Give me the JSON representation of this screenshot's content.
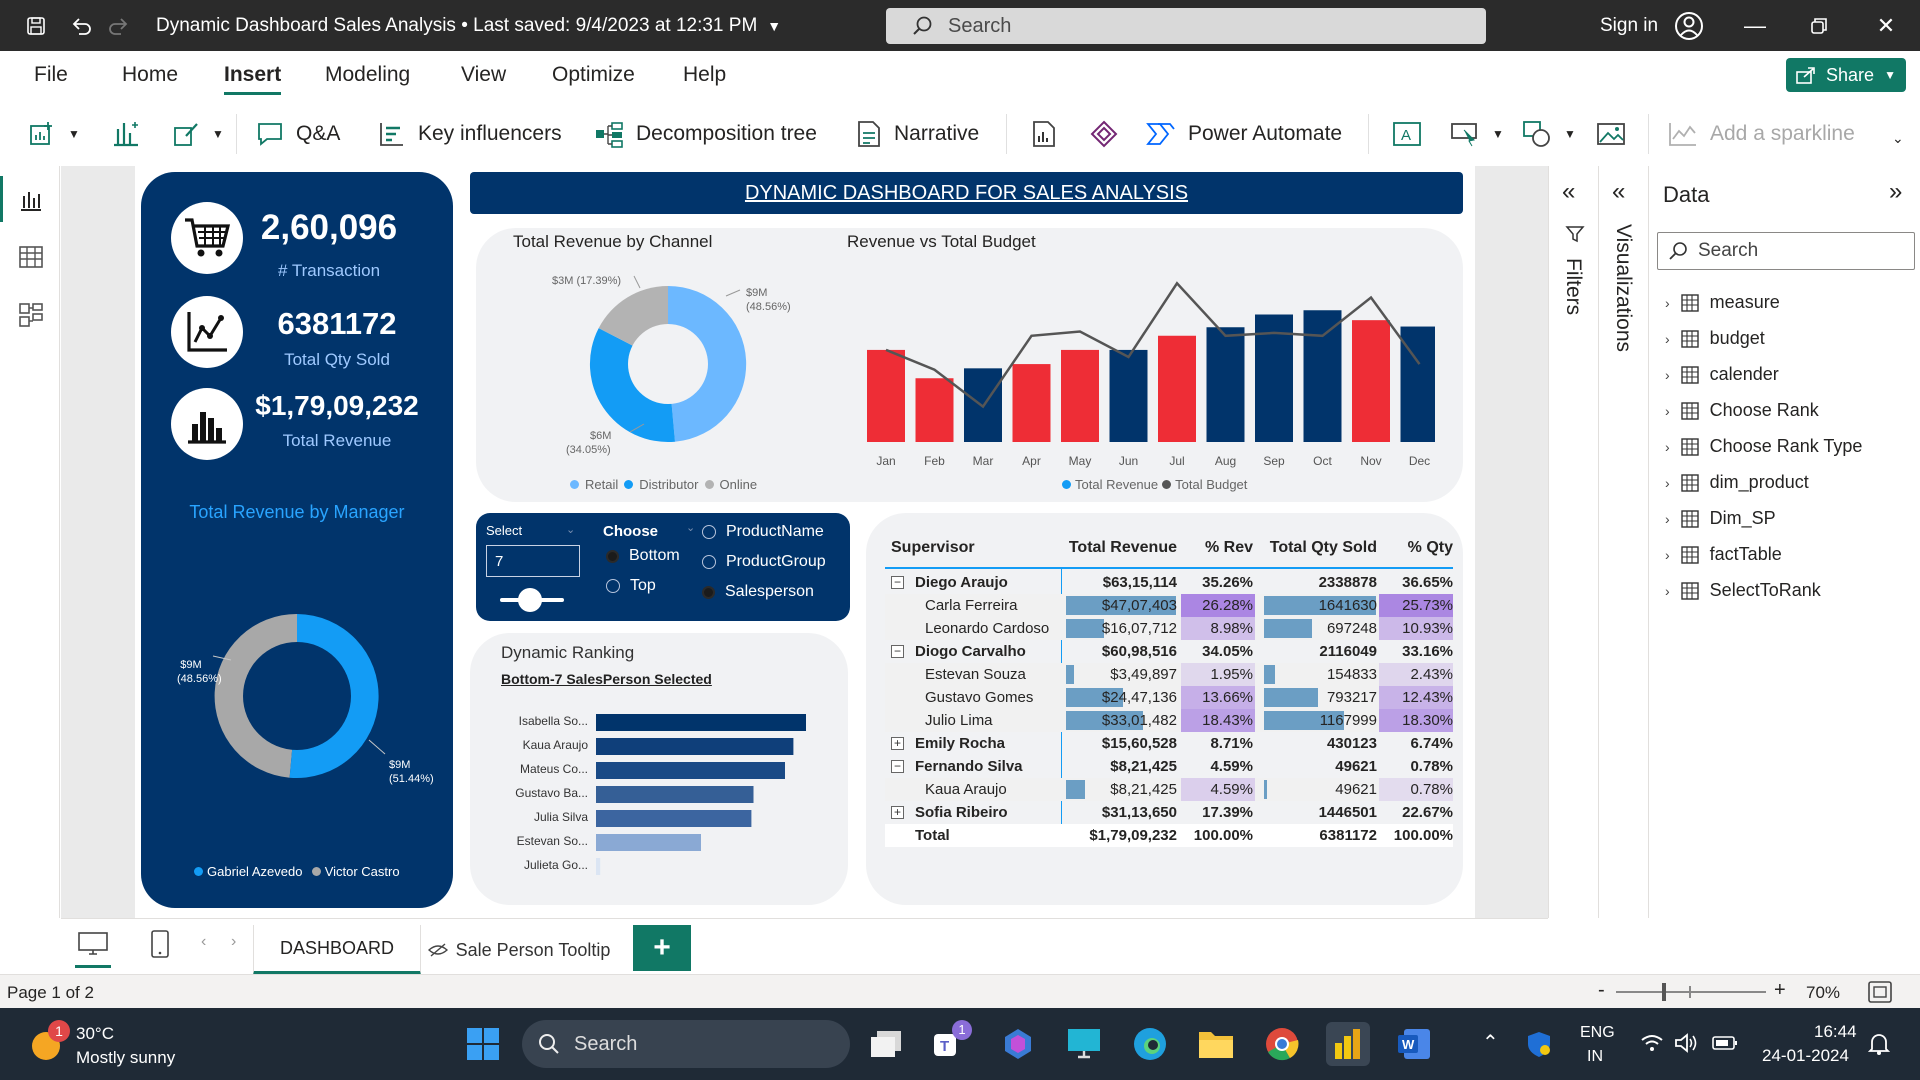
{
  "window": {
    "title": "Dynamic Dashboard Sales Analysis • Last saved: 9/4/2023 at 12:31 PM",
    "search_placeholder": "Search",
    "signin": "Sign in"
  },
  "menu": {
    "items": [
      "File",
      "Home",
      "Insert",
      "Modeling",
      "View",
      "Optimize",
      "Help"
    ],
    "active": "Insert",
    "share": "Share"
  },
  "ribbon": {
    "qa": "Q&A",
    "key_influencers": "Key influencers",
    "decomposition": "Decomposition tree",
    "narrative": "Narrative",
    "power_automate": "Power Automate",
    "sparkline": "Add a sparkline"
  },
  "dashboard": {
    "header": "DYNAMIC DASHBOARD FOR SALES ANALYSIS",
    "kpis": [
      {
        "value": "2,60,096",
        "label": "# Transaction"
      },
      {
        "value": "6381172",
        "label": "Total Qty Sold"
      },
      {
        "value": "$1,79,09,232",
        "label": "Total Revenue"
      }
    ],
    "manager_title": "Total Revenue by Manager",
    "manager_donut": {
      "slices": [
        {
          "name": "Victor Castro",
          "value": 48.56,
          "label": "$9M",
          "pct": "(48.56%)",
          "color": "#a8a8a8"
        },
        {
          "name": "Gabriel Azevedo",
          "value": 51.44,
          "label": "$9M",
          "pct": "(51.44%)",
          "color": "#139cf5"
        }
      ],
      "legend": [
        "Gabriel Azevedo",
        "Victor Castro"
      ]
    },
    "channel": {
      "title": "Total Revenue by Channel",
      "slices": [
        {
          "name": "Retail",
          "value": 48.56,
          "label": "$9M",
          "pct": "(48.56%)",
          "color": "#6cb8ff"
        },
        {
          "name": "Distributor",
          "value": 34.05,
          "label": "$6M",
          "pct": "(34.05%)",
          "color": "#139cf5"
        },
        {
          "name": "Online",
          "value": 17.39,
          "label": "$3M (17.39%)",
          "pct": "",
          "color": "#b3b3b3"
        }
      ],
      "legend": [
        "Retail",
        "Distributor",
        "Online"
      ]
    },
    "budget": {
      "title": "Revenue vs Total Budget",
      "legend": [
        "Total Revenue",
        "Total Budget"
      ]
    },
    "select": {
      "label": "Select",
      "value": "7",
      "choose_label": "Choose",
      "choose_options": [
        "Bottom",
        "Top"
      ],
      "choose_selected": "Bottom",
      "type_options": [
        "ProductName",
        "ProductGroup",
        "Salesperson"
      ],
      "type_selected": "Salesperson"
    },
    "ranking": {
      "title": "Dynamic Ranking",
      "subtitle": "Bottom-7 SalesPerson Selected"
    },
    "matrix": {
      "headers": [
        "Supervisor",
        "Total Revenue",
        "% Rev",
        "Total Qty Sold",
        "% Qty"
      ],
      "rows": [
        {
          "level": 0,
          "toggle": "−",
          "name": "Diego Araujo",
          "rev": "$63,15,114",
          "prev": "35.26%",
          "qty": "2338878",
          "pqty": "36.65%"
        },
        {
          "level": 1,
          "toggle": "",
          "name": "Carla Ferreira",
          "rev": "$47,07,403",
          "prev": "26.28%",
          "qty": "1641630",
          "pqty": "25.73%"
        },
        {
          "level": 1,
          "toggle": "",
          "name": "Leonardo Cardoso",
          "rev": "$16,07,712",
          "prev": "8.98%",
          "qty": "697248",
          "pqty": "10.93%"
        },
        {
          "level": 0,
          "toggle": "−",
          "name": "Diogo Carvalho",
          "rev": "$60,98,516",
          "prev": "34.05%",
          "qty": "2116049",
          "pqty": "33.16%"
        },
        {
          "level": 1,
          "toggle": "",
          "name": "Estevan Souza",
          "rev": "$3,49,897",
          "prev": "1.95%",
          "qty": "154833",
          "pqty": "2.43%"
        },
        {
          "level": 1,
          "toggle": "",
          "name": "Gustavo Gomes",
          "rev": "$24,47,136",
          "prev": "13.66%",
          "qty": "793217",
          "pqty": "12.43%"
        },
        {
          "level": 1,
          "toggle": "",
          "name": "Julio Lima",
          "rev": "$33,01,482",
          "prev": "18.43%",
          "qty": "1167999",
          "pqty": "18.30%"
        },
        {
          "level": 0,
          "toggle": "+",
          "name": "Emily Rocha",
          "rev": "$15,60,528",
          "prev": "8.71%",
          "qty": "430123",
          "pqty": "6.74%"
        },
        {
          "level": 0,
          "toggle": "−",
          "name": "Fernando Silva",
          "rev": "$8,21,425",
          "prev": "4.59%",
          "qty": "49621",
          "pqty": "0.78%"
        },
        {
          "level": 1,
          "toggle": "",
          "name": "Kaua Araujo",
          "rev": "$8,21,425",
          "prev": "4.59%",
          "qty": "49621",
          "pqty": "0.78%"
        },
        {
          "level": 0,
          "toggle": "+",
          "name": "Sofia Ribeiro",
          "rev": "$31,13,650",
          "prev": "17.39%",
          "qty": "1446501",
          "pqty": "22.67%"
        },
        {
          "level": 0,
          "toggle": "",
          "name": "Total",
          "rev": "$1,79,09,232",
          "prev": "100.00%",
          "qty": "6381172",
          "pqty": "100.00%"
        }
      ]
    }
  },
  "chart_data": [
    {
      "type": "bar",
      "title": "Revenue vs Total Budget",
      "categories": [
        "Jan",
        "Feb",
        "Mar",
        "Apr",
        "May",
        "Jun",
        "Jul",
        "Aug",
        "Sep",
        "Oct",
        "Nov",
        "Dec"
      ],
      "series": [
        {
          "name": "Total Revenue",
          "values": [
            1.3,
            0.9,
            1.04,
            1.1,
            1.3,
            1.3,
            1.5,
            1.62,
            1.8,
            1.86,
            1.72,
            1.63
          ],
          "colors": [
            "#ee2d36",
            "#ee2d36",
            "#01346b",
            "#ee2d36",
            "#ee2d36",
            "#01346b",
            "#ee2d36",
            "#01346b",
            "#01346b",
            "#01346b",
            "#ee2d36",
            "#01346b"
          ]
        },
        {
          "name": "Total Budget",
          "type": "line",
          "values": [
            1.3,
            1.02,
            0.5,
            1.5,
            1.56,
            1.2,
            2.24,
            1.5,
            1.54,
            1.5,
            2.04,
            1.1
          ],
          "color": "#555555"
        }
      ],
      "xlabel": "",
      "ylabel": ""
    },
    {
      "type": "bar",
      "title": "Dynamic Ranking",
      "orientation": "horizontal",
      "categories": [
        "Isabella So...",
        "Kaua Araujo",
        "Mateus Co...",
        "Gustavo Ba...",
        "Julia Silva",
        "Estevan So...",
        "Julieta Go..."
      ],
      "values": [
        100,
        94,
        90,
        75,
        74,
        50,
        2
      ],
      "colors": [
        "#01346b",
        "#0f3f7a",
        "#1a4a86",
        "#355f96",
        "#3c65a0",
        "#8aa9d4",
        "#dbe5f3"
      ]
    },
    {
      "type": "pie",
      "title": "Total Revenue by Channel",
      "categories": [
        "Retail",
        "Distributor",
        "Online"
      ],
      "values": [
        48.56,
        34.05,
        17.39
      ]
    },
    {
      "type": "pie",
      "title": "Total Revenue by Manager",
      "categories": [
        "Victor Castro",
        "Gabriel Azevedo"
      ],
      "values": [
        48.56,
        51.44
      ]
    }
  ],
  "panes": {
    "filters": "Filters",
    "visualizations": "Visualizations",
    "data_title": "Data",
    "data_search": "Search",
    "data_items": [
      "measure",
      "budget",
      "calender",
      "Choose Rank",
      "Choose Rank Type",
      "dim_product",
      "Dim_SP",
      "factTable",
      "SelectToRank"
    ]
  },
  "tabs": {
    "items": [
      "DASHBOARD",
      "Sale Person Tooltip"
    ],
    "active": "DASHBOARD",
    "add": "+"
  },
  "status": {
    "page": "Page 1 of 2",
    "zoom": "70%"
  },
  "taskbar": {
    "weather_temp": "30°C",
    "weather_desc": "Mostly sunny",
    "search": "Search",
    "lang1": "ENG",
    "lang2": "IN",
    "time": "16:44",
    "date": "24-01-2024"
  }
}
